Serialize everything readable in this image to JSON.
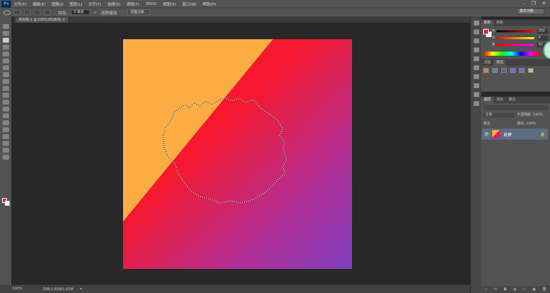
{
  "app": {
    "logo": "Ps",
    "workspace": "基本功能"
  },
  "menu": [
    "文件(F)",
    "编辑(E)",
    "图像(I)",
    "图层(L)",
    "文字(Y)",
    "选择(S)",
    "滤镜(T)",
    "3D(D)",
    "视图(V)",
    "窗口(W)",
    "帮助(H)"
  ],
  "window_controls": {
    "minimize": "–",
    "restore": "❐",
    "close": "✕"
  },
  "options": {
    "feather_label": "羽化:",
    "feather_value": "0 像素",
    "antialias_label": "消除锯齿",
    "refine_edge": "调整边缘..."
  },
  "document": {
    "tab": "未标题-1 @ 100%(RGB/8) ×"
  },
  "colors": {
    "foreground": "#ee1f2a",
    "background": "#ffffff",
    "orange": "#fbad44",
    "red": "#ef2030",
    "purple": "#8b3cbc"
  },
  "color_panel": {
    "tabs": [
      "颜色",
      "色板"
    ],
    "channels": [
      {
        "label": "R",
        "value": "250"
      },
      {
        "label": "G",
        "value": "4"
      },
      {
        "label": "B",
        "value": "32"
      }
    ]
  },
  "styles_panel": {
    "tabs": [
      "调整",
      "样式"
    ]
  },
  "layers_panel": {
    "tabs": [
      "图层",
      "通道",
      "路径"
    ],
    "blend_mode": "正常",
    "opacity_label": "不透明度: 100%",
    "lock_label": "锁定:",
    "fill_label": "填充: 100%",
    "layers": [
      {
        "name": "背景"
      }
    ]
  },
  "status": {
    "zoom": "100%",
    "doc": "文档:1.61M/1.61M"
  }
}
